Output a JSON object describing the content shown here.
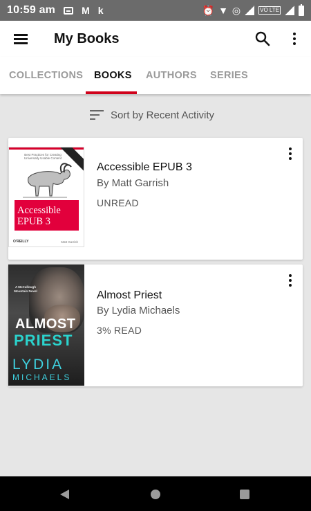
{
  "status_bar": {
    "time": "10:59 am",
    "notif_k": "k",
    "vo_label": "VO LTE"
  },
  "app_bar": {
    "title": "My Books"
  },
  "tabs": [
    {
      "label": "COLLECTIONS",
      "active": false
    },
    {
      "label": "BOOKS",
      "active": true
    },
    {
      "label": "AUTHORS",
      "active": false
    },
    {
      "label": "SERIES",
      "active": false
    }
  ],
  "sort": {
    "label": "Sort by Recent Activity"
  },
  "books": [
    {
      "title": "Accessible EPUB 3",
      "author": "By Matt Garrish",
      "status": "UNREAD",
      "cover": {
        "tagline": "Best Practices for Creating Universally Usable Content",
        "band_line1": "Accessible",
        "band_line2": "EPUB 3",
        "publisher": "O'REILLY",
        "author": "Matt Garrish",
        "accent": "#e2003c"
      }
    },
    {
      "title": "Almost Priest",
      "author": "By Lydia Michaels",
      "status": "3% READ",
      "cover": {
        "series": "A McCullough Mountain Novel",
        "title_line1": "ALMOST",
        "title_line2": "PRIEST",
        "author_line1": "LYDIA",
        "author_line2": "MICHAELS",
        "accent": "#2bd3cd"
      }
    }
  ],
  "colors": {
    "accent_red": "#d0021b",
    "background": "#e6e6e6",
    "status_bar": "#6b6b6b"
  }
}
